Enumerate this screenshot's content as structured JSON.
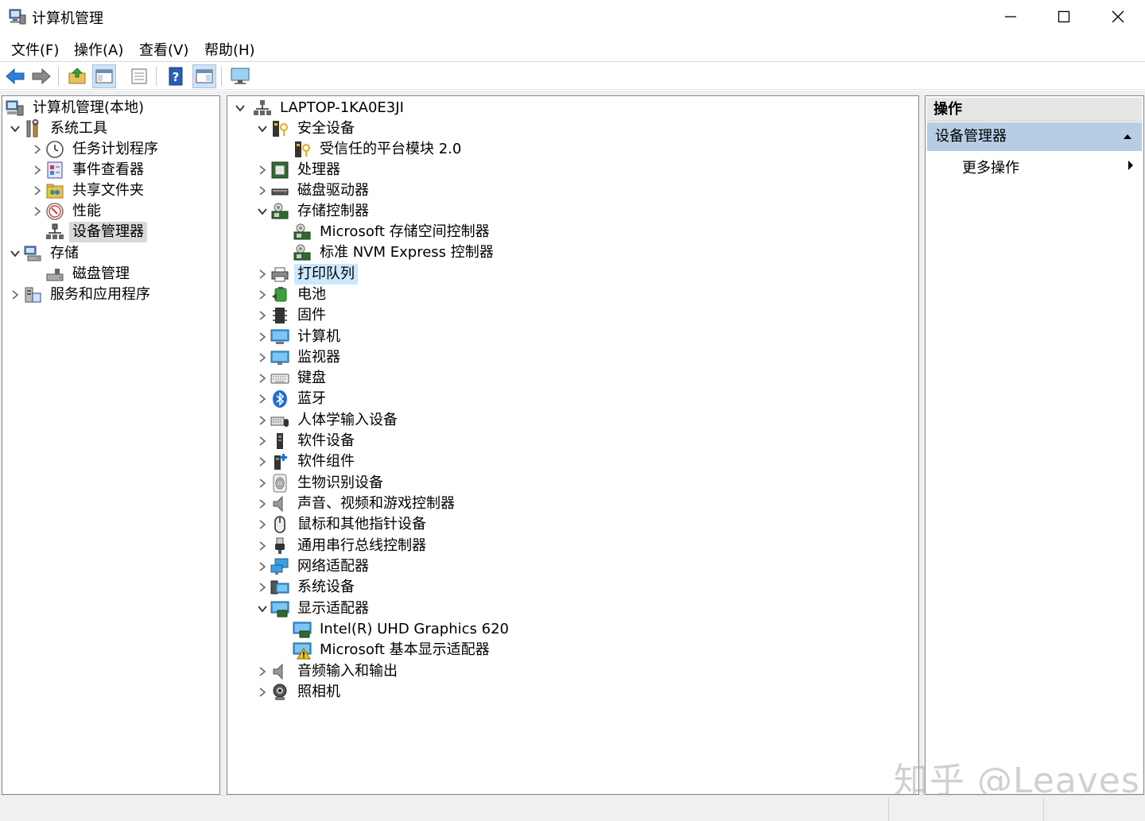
{
  "window": {
    "title": "计算机管理",
    "icon": "computer-management-icon",
    "minimize": "minimize-icon",
    "maximize": "maximize-icon",
    "close": "close-icon"
  },
  "menubar": {
    "items": [
      "文件(F)",
      "操作(A)",
      "查看(V)",
      "帮助(H)"
    ]
  },
  "toolbar": {
    "buttons": [
      "back-arrow-icon",
      "forward-arrow-icon",
      "up-folder-icon",
      "show-console-tree-icon",
      "properties-icon",
      "help-icon",
      "show-action-pane-icon",
      "monitor-icon"
    ]
  },
  "left_tree": {
    "items": [
      {
        "label": "计算机管理(本地)",
        "icon": "computer-management-icon"
      },
      {
        "label": "系统工具",
        "icon": "tools-icon"
      },
      {
        "label": "任务计划程序",
        "icon": "clock-icon"
      },
      {
        "label": "事件查看器",
        "icon": "event-viewer-icon"
      },
      {
        "label": "共享文件夹",
        "icon": "shared-folder-icon"
      },
      {
        "label": "性能",
        "icon": "performance-icon"
      },
      {
        "label": "设备管理器",
        "icon": "device-manager-icon"
      },
      {
        "label": "存储",
        "icon": "storage-icon"
      },
      {
        "label": "磁盘管理",
        "icon": "disk-management-icon"
      },
      {
        "label": "服务和应用程序",
        "icon": "services-icon"
      }
    ]
  },
  "device_tree": {
    "items": [
      {
        "label": "LAPTOP-1KA0E3JI",
        "icon": "computer-root-icon"
      },
      {
        "label": "安全设备",
        "icon": "security-device-icon"
      },
      {
        "label": "受信任的平台模块 2.0",
        "icon": "security-device-icon"
      },
      {
        "label": "处理器",
        "icon": "processor-icon"
      },
      {
        "label": "磁盘驱动器",
        "icon": "disk-drive-icon"
      },
      {
        "label": "存储控制器",
        "icon": "storage-controller-icon"
      },
      {
        "label": "Microsoft 存储空间控制器",
        "icon": "storage-controller-icon"
      },
      {
        "label": "标准 NVM Express 控制器",
        "icon": "storage-controller-icon"
      },
      {
        "label": "打印队列",
        "icon": "printer-icon"
      },
      {
        "label": "电池",
        "icon": "battery-icon"
      },
      {
        "label": "固件",
        "icon": "firmware-icon"
      },
      {
        "label": "计算机",
        "icon": "computer-icon"
      },
      {
        "label": "监视器",
        "icon": "monitor-icon"
      },
      {
        "label": "键盘",
        "icon": "keyboard-icon"
      },
      {
        "label": "蓝牙",
        "icon": "bluetooth-icon"
      },
      {
        "label": "人体学输入设备",
        "icon": "hid-icon"
      },
      {
        "label": "软件设备",
        "icon": "software-device-icon"
      },
      {
        "label": "软件组件",
        "icon": "software-component-icon"
      },
      {
        "label": "生物识别设备",
        "icon": "fingerprint-icon"
      },
      {
        "label": "声音、视频和游戏控制器",
        "icon": "speaker-icon"
      },
      {
        "label": "鼠标和其他指针设备",
        "icon": "mouse-icon"
      },
      {
        "label": "通用串行总线控制器",
        "icon": "usb-icon"
      },
      {
        "label": "网络适配器",
        "icon": "network-adapter-icon"
      },
      {
        "label": "系统设备",
        "icon": "system-device-icon"
      },
      {
        "label": "显示适配器",
        "icon": "display-adapter-icon"
      },
      {
        "label": "Intel(R) UHD Graphics 620",
        "icon": "display-adapter-icon"
      },
      {
        "label": "Microsoft 基本显示适配器",
        "icon": "display-adapter-warning-icon"
      },
      {
        "label": "音频输入和输出",
        "icon": "speaker-icon"
      },
      {
        "label": "照相机",
        "icon": "camera-icon"
      }
    ]
  },
  "actions_pane": {
    "header": "操作",
    "section": "设备管理器",
    "items": [
      "更多操作"
    ]
  },
  "watermark": "知乎 @Leaves",
  "colors": {
    "selected_bg": "#d9d9d9",
    "focus_bg": "#cce8ff",
    "actions_section_bg": "#b6cde3",
    "pane_border": "#828790"
  }
}
